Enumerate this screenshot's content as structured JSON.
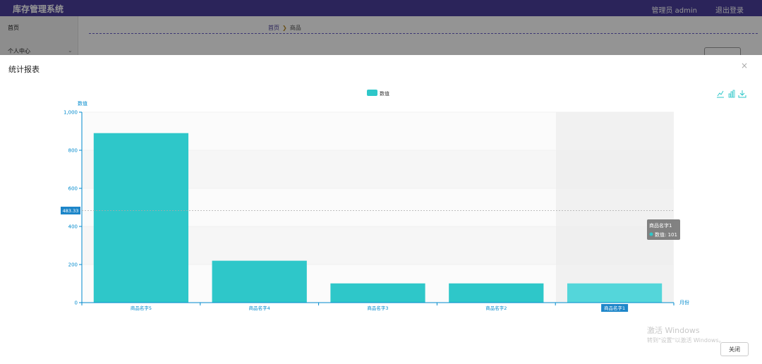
{
  "app": {
    "title": "库存管理系统",
    "user": "管理员 admin",
    "logout": "退出登录"
  },
  "sidebar": {
    "items": [
      {
        "label": "首页"
      },
      {
        "label": "个人中心"
      }
    ]
  },
  "breadcrumb": {
    "home": "首页",
    "current": "商品"
  },
  "modal": {
    "title": "统计报表",
    "close_label": "关闭"
  },
  "watermark": {
    "line1": "激活 Windows",
    "line2": "转到\"设置\"以激活 Windows。"
  },
  "colors": {
    "bar": "#2ec7c9",
    "bar_highlight": "#54d6da",
    "axis": "#008acd",
    "topbar": "#4a3f9b"
  },
  "chart_data": {
    "type": "bar",
    "categories": [
      "商品名字5",
      "商品名字4",
      "商品名字3",
      "商品名字2",
      "商品名字1"
    ],
    "series": [
      {
        "name": "数值",
        "values": [
          890,
          220,
          101,
          101,
          101
        ]
      }
    ],
    "xlabel": "月份",
    "ylabel": "数值",
    "ylim": [
      0,
      1000
    ],
    "yticks": [
      "0",
      "200",
      "400",
      "600",
      "800",
      "1,000"
    ],
    "grid": true,
    "legend": "top-center",
    "axis_pointer_value": "483.33",
    "highlighted_category": "商品名字1",
    "tooltip": {
      "title": "商品名字1",
      "line": "数值: 101"
    }
  }
}
